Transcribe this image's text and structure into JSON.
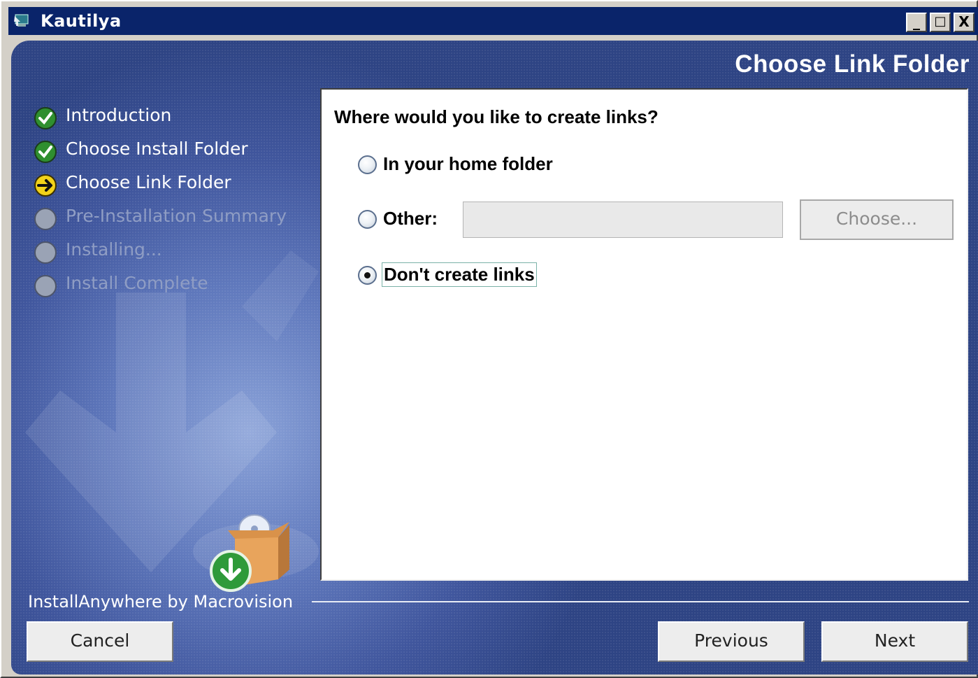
{
  "window": {
    "title": "Kautilya",
    "controls": {
      "minimize": "_",
      "maximize": "□",
      "close": "X"
    }
  },
  "page": {
    "header": "Choose Link Folder"
  },
  "steps": [
    {
      "label": "Introduction",
      "state": "done",
      "icon": "check-icon"
    },
    {
      "label": "Choose Install Folder",
      "state": "done",
      "icon": "check-icon"
    },
    {
      "label": "Choose Link Folder",
      "state": "current",
      "icon": "arrow-right-icon"
    },
    {
      "label": "Pre-Installation Summary",
      "state": "pending",
      "icon": "circle-icon"
    },
    {
      "label": "Installing...",
      "state": "pending",
      "icon": "circle-icon"
    },
    {
      "label": "Install Complete",
      "state": "pending",
      "icon": "circle-icon"
    }
  ],
  "content": {
    "question": "Where would you like to create links?",
    "options": [
      {
        "label": "In your home folder",
        "selected": false
      },
      {
        "label": "Other:",
        "selected": false
      },
      {
        "label": "Don't create links",
        "selected": true
      }
    ],
    "other_path_value": "",
    "choose_button": "Choose..."
  },
  "footer": {
    "brand": "InstallAnywhere by Macrovision",
    "cancel": "Cancel",
    "previous": "Previous",
    "next": "Next"
  },
  "colors": {
    "titlebar": "#0a246a",
    "panel_blue": "#40569d",
    "check_green": "#2f8f2f",
    "current_yellow": "#f2d21a"
  }
}
